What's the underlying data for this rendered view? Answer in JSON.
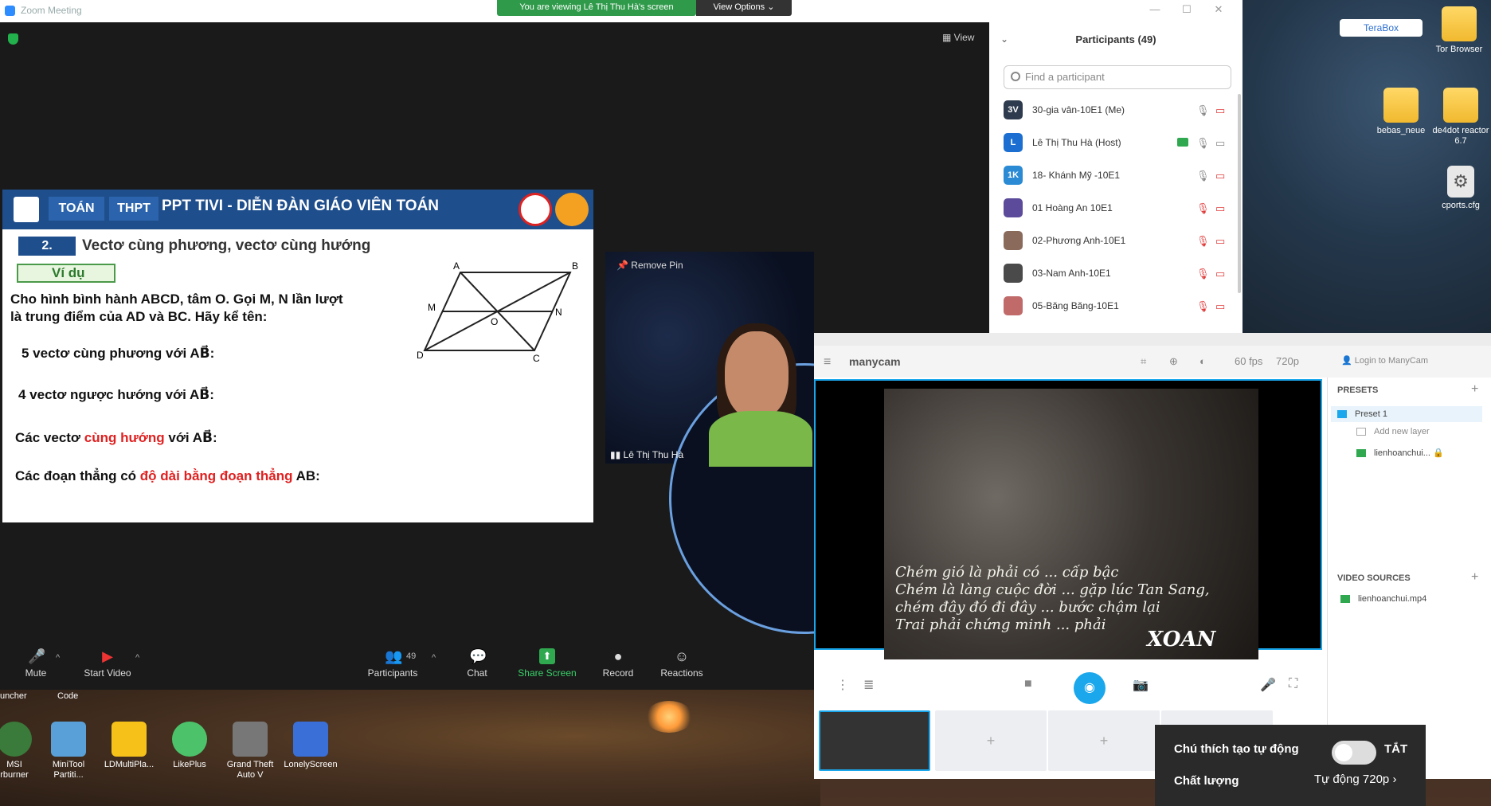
{
  "zoom": {
    "app_title": "Zoom Meeting",
    "banner": "You are viewing Lê Thị Thu Hà's screen",
    "view_options": "View Options ⌄",
    "view_label": "View",
    "window_controls": [
      "—",
      "☐",
      "✕"
    ]
  },
  "slide": {
    "tabs": [
      "TOÁN",
      "THPT"
    ],
    "title": "PPT TIVI - DIỄN ĐÀN GIÁO VIÊN TOÁN",
    "section_num": "2.",
    "section_title": "Vectơ cùng phương, vectơ cùng hướng",
    "example": "Ví dụ",
    "problem_line1": "Cho hình bình hành ABCD, tâm O. Gọi M, N lần lượt",
    "problem_line2": "là trung điểm của AD và BC. Hãy kể tên:",
    "q1": "5 vectơ cùng phương với AB⃗:",
    "q2": "4 vectơ ngược hướng với AB⃗:",
    "q3_pre": "Các vectơ ",
    "q3_red": "cùng hướng",
    "q3_post": " với AB⃗:",
    "q4_pre": "Các đoạn thẳng có ",
    "q4_red": "độ dài bằng đoạn thẳng",
    "q4_post": " AB:",
    "geom_labels": {
      "A": "A",
      "B": "B",
      "C": "C",
      "D": "D",
      "M": "M",
      "N": "N",
      "O": "O"
    }
  },
  "presenter": {
    "remove_pin": "Remove Pin",
    "name": "Lê Thị Thu Hà"
  },
  "participants": {
    "header": "Participants (49)",
    "search_placeholder": "Find a participant",
    "list": [
      {
        "initials": "3V",
        "name": "30-gia vân-10E1 (Me)",
        "color": "#2e3b4e"
      },
      {
        "initials": "L",
        "name": "Lê Thị Thu Hà (Host)",
        "color": "#1c6fd1"
      },
      {
        "initials": "1K",
        "name": "18- Khánh Mỹ -10E1",
        "color": "#2a8ad4"
      },
      {
        "initials": "",
        "name": "01 Hoàng An 10E1",
        "color": "#5b4b9a"
      },
      {
        "initials": "",
        "name": "02-Phương Anh-10E1",
        "color": "#8a6a5a"
      },
      {
        "initials": "",
        "name": "03-Nam Anh-10E1",
        "color": "#4a4a4a"
      },
      {
        "initials": "",
        "name": "05-Băng Băng-10E1",
        "color": "#c06a6a"
      }
    ]
  },
  "toolbar": {
    "mute": "Mute",
    "start_video": "Start Video",
    "participants": "Participants",
    "participants_count": "49",
    "chat": "Chat",
    "share_screen": "Share Screen",
    "record": "Record",
    "reactions": "Reactions"
  },
  "desktop_icons": [
    {
      "label": "TeraBox"
    },
    {
      "label": "Tor Browser"
    },
    {
      "label": "bebas_neue"
    },
    {
      "label": "de4dot reactor 6.7"
    },
    {
      "label": "cports.cfg"
    },
    {
      "label": "MSI\nrburner"
    },
    {
      "label": "MiniTool\nPartiti..."
    },
    {
      "label": "LDMultiPla..."
    },
    {
      "label": "LikePlus"
    },
    {
      "label": "Grand Theft\nAuto V"
    },
    {
      "label": "LonelyScreen"
    }
  ],
  "taskbar_partial": [
    "uncher",
    "Code"
  ],
  "manycam": {
    "logo": "manycam",
    "fps": "60 fps",
    "res": "720p",
    "login": "Login to ManyCam",
    "presets_header": "PRESETS",
    "preset1": "Preset 1",
    "add_layer": "Add new layer",
    "layer_file": "lienhoanchui...",
    "video_sources_header": "VIDEO SOURCES",
    "source_file": "lienhoanchui.mp4",
    "video_text": "Chém gió là phải có ... cấp bậc\nChém là làng cuộc đời ... gặp lúc Tan Sang,\nchém đây đó đi đây ... bước chậm lại\nTrai phải chứng minh ... phải",
    "video_title": "XOAN"
  },
  "captions": {
    "auto_label": "Chú thích tạo tự động",
    "toggle_state": "TẮT",
    "quality_label": "Chất lượng",
    "quality_value": "Tự động 720p ›"
  }
}
